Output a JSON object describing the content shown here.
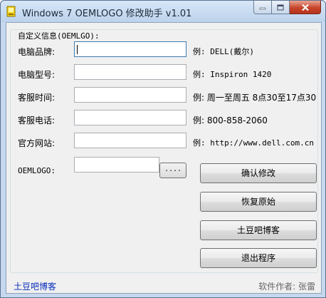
{
  "window": {
    "title": "Windows 7 OEMLOGO 修改助手 v1.01"
  },
  "group": {
    "title": "自定义信息(OEMLGO):"
  },
  "fields": [
    {
      "label": "电脑品牌:",
      "value": "",
      "example": "例: DELL(戴尔)"
    },
    {
      "label": "电脑型号:",
      "value": "",
      "example": "例: Inspiron 1420"
    },
    {
      "label": "客服时间:",
      "value": "",
      "example": "例: 周一至周五 8点30至17点30"
    },
    {
      "label": "客服电话:",
      "value": "",
      "example": "例: 800-858-2060"
    },
    {
      "label": "官方网站:",
      "value": "",
      "example": "例: http://www.dell.com.cn"
    }
  ],
  "oemlogo": {
    "label": "OEMLOGO:",
    "value": "",
    "browse_label": "...."
  },
  "buttons": {
    "confirm": "确认修改",
    "restore": "恢复原始",
    "blog": "土豆吧博客",
    "exit": "退出程序"
  },
  "footer": {
    "link": "土豆吧博客",
    "author": "软件作者: 张雷"
  }
}
